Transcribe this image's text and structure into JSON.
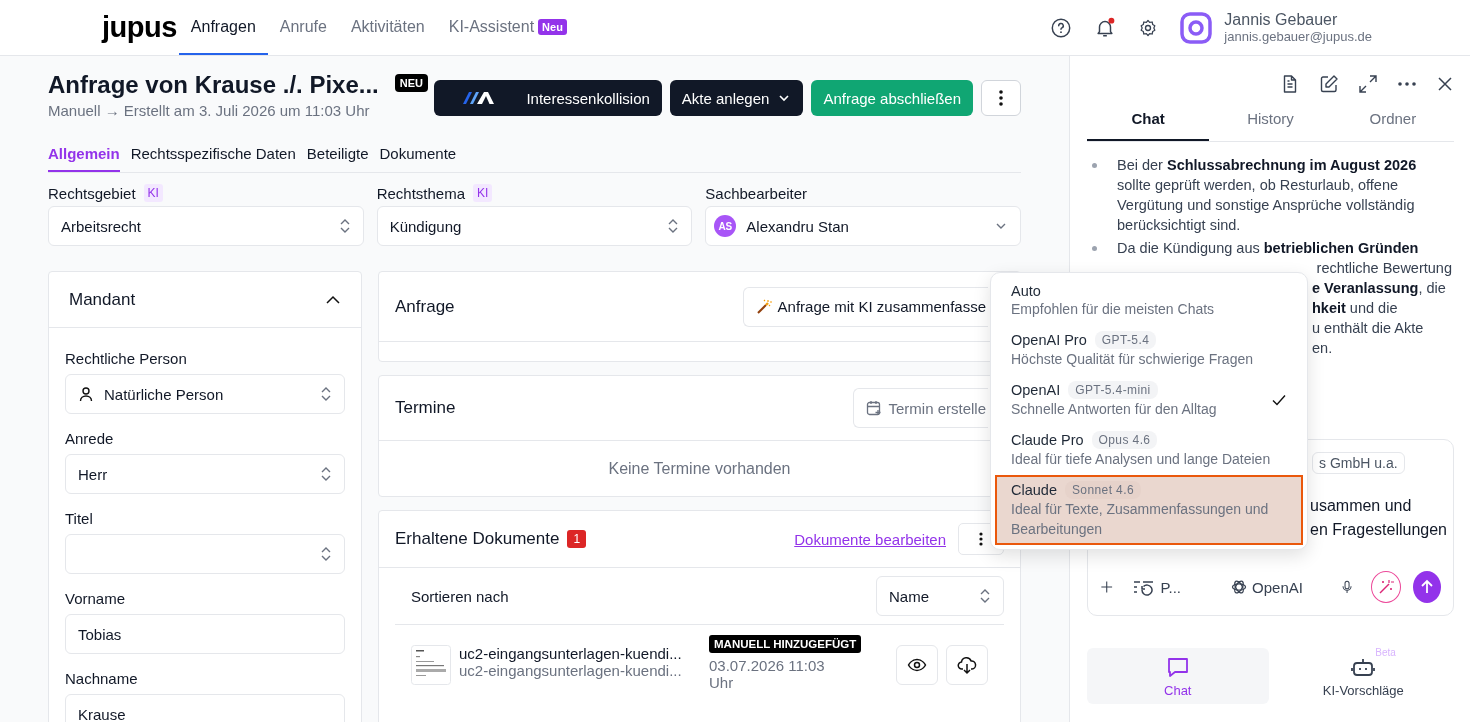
{
  "nav": {
    "logo": "jupus",
    "tabs": [
      {
        "label": "Anfragen",
        "selected": true
      },
      {
        "label": "Anrufe",
        "selected": false
      },
      {
        "label": "Aktivitäten",
        "selected": false
      },
      {
        "label": "KI-Assistent",
        "selected": false,
        "badge": "Neu"
      }
    ],
    "notifications_unread": true,
    "user": {
      "name": "Jannis Gebauer",
      "email": "jannis.gebauer@jupus.de"
    }
  },
  "header": {
    "title": "Anfrage von Krause ./. Pixe...",
    "badge": "NEU",
    "subtitle": "Manuell → Erstellt am 3. Juli 2026 um 11:03 Uhr",
    "buttons": [
      {
        "kind": "logo",
        "label": "Interessenkollision"
      },
      {
        "kind": "dropdown",
        "label": "Akte anlegen"
      },
      {
        "kind": "primary",
        "label": "Anfrage abschließen"
      },
      {
        "kind": "more"
      }
    ]
  },
  "tabs": [
    {
      "label": "Allgemein",
      "selected": true
    },
    {
      "label": "Rechtsspezifische Daten",
      "selected": false
    },
    {
      "label": "Beteiligte",
      "selected": false
    },
    {
      "label": "Dokumente",
      "selected": false
    }
  ],
  "fields": [
    {
      "kind": "select",
      "label": "Rechtsgebiet",
      "ki": "KI",
      "value": "Arbeitsrecht"
    },
    {
      "kind": "select",
      "label": "Rechtsthema",
      "ki": "KI",
      "value": "Kündigung"
    },
    {
      "kind": "person",
      "label": "Sachbearbeiter",
      "avatar": "AS",
      "value": "Alexandru Stan"
    }
  ],
  "mandant": {
    "title": "Mandant",
    "expanded": true,
    "fields": [
      {
        "kind": "person-select",
        "label": "Rechtliche Person",
        "value": "Natürliche Person"
      },
      {
        "kind": "select",
        "label": "Anrede",
        "value": "Herr"
      },
      {
        "kind": "select",
        "label": "Titel"
      },
      {
        "kind": "input",
        "label": "Vorname",
        "value": "Tobias"
      },
      {
        "kind": "input",
        "label": "Nachname",
        "value": "Krause"
      }
    ]
  },
  "anfrage": {
    "title": "Anfrage",
    "button": "Anfrage mit KI zusammenfasse"
  },
  "termine": {
    "title": "Termine",
    "button": "Termin erstelle",
    "empty": "Keine Termine vorhanden"
  },
  "dokumente": {
    "title": "Erhaltene Dokumente",
    "count": "1",
    "link": "Dokumente bearbeiten",
    "sort_label": "Sortieren nach",
    "sort_value": "Name",
    "rows": [
      {
        "name": "uc2-eingangsunterlagen-kuendi...",
        "file": "uc2-eingangsunterlagen-kuendi...",
        "tag": "MANUELL HINZUGEFÜGT",
        "date": "03.07.2026 11:03 Uhr"
      }
    ]
  },
  "chat": {
    "tabs": [
      {
        "label": "Chat",
        "selected": true
      },
      {
        "label": "History",
        "selected": false
      },
      {
        "label": "Ordner",
        "selected": false
      }
    ],
    "bullets": [
      {
        "lines": [
          {
            "kind": "full",
            "text": "Bei der **Schlussabrechnung im August 2026** sollte geprüft werden, ob Resturlaub, offene Vergütung und sonstige Ansprüche vollständig berücksichtigt sind."
          }
        ]
      },
      {
        "lines": [
          {
            "kind": "full",
            "text": "Da die Kündigung aus **betrieblichen Gründen**"
          },
          {
            "kind": "tail",
            "text": "rechtliche Bewertung"
          },
          {
            "kind": "after-menu",
            "text": "**e Veranlassung**, die"
          },
          {
            "kind": "after-menu",
            "text": "**hkeit** und die"
          },
          {
            "kind": "after-menu",
            "text": "u enthält die Akte"
          },
          {
            "kind": "after-menu",
            "text": "en."
          }
        ]
      }
    ],
    "composer": {
      "chip": "s GmbH u.a.",
      "lines": [
        "usammen und",
        "en Fragestellungen"
      ],
      "prompt_button": "P...",
      "model": "OpenAI"
    },
    "bottom_tabs": [
      {
        "label": "Chat",
        "selected": true
      },
      {
        "label": "KI-Vorschläge",
        "selected": false,
        "badge": "Beta"
      }
    ]
  },
  "model_menu": [
    {
      "name": "Auto",
      "description": "Empfohlen für die meisten Chats",
      "checked": false,
      "highlighted": false
    },
    {
      "name": "OpenAI Pro",
      "tag": "GPT-5.4",
      "description": "Höchste Qualität für schwierige Fragen",
      "checked": false,
      "highlighted": false
    },
    {
      "name": "OpenAI",
      "tag": "GPT-5.4-mini",
      "description": "Schnelle Antworten für den Alltag",
      "checked": true,
      "highlighted": false
    },
    {
      "name": "Claude Pro",
      "tag": "Opus 4.6",
      "description": "Ideal für tiefe Analysen und lange Dateien",
      "checked": false,
      "highlighted": false
    },
    {
      "name": "Claude",
      "tag": "Sonnet 4.6",
      "description": "Ideal für Texte, Zusammenfassungen und Bearbeitungen",
      "checked": false,
      "highlighted": true
    }
  ]
}
